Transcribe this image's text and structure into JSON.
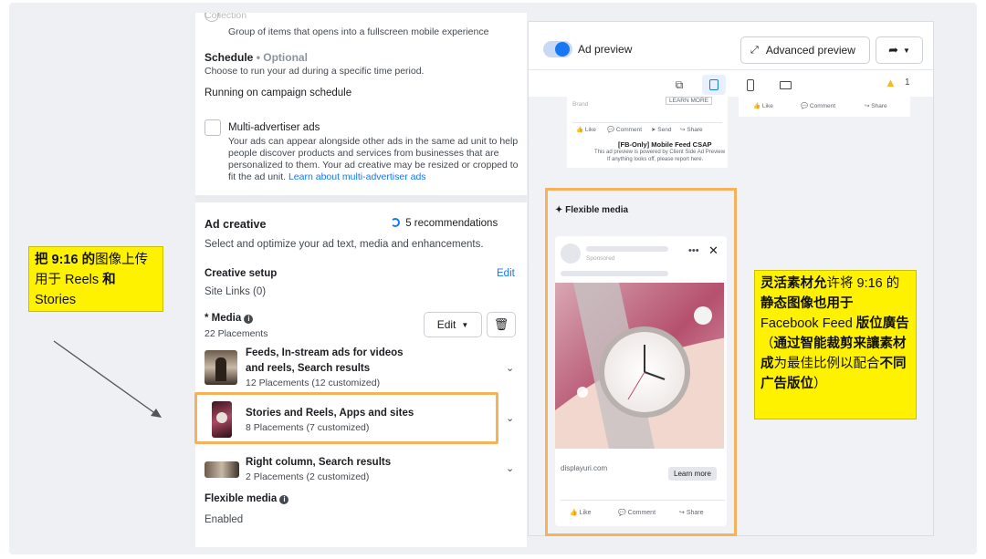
{
  "collection": {
    "title": "Collection",
    "desc": "Group of items that opens into a fullscreen mobile experience"
  },
  "schedule": {
    "title": "Schedule",
    "optional": "Optional",
    "desc": "Choose to run your ad during a specific time period.",
    "value": "Running on campaign schedule"
  },
  "multi_advertiser": {
    "title": "Multi-advertiser ads",
    "lines": [
      "Your ads can appear alongside other ads in the same ad unit to help",
      "people discover products and services from businesses that are",
      "personalized to them. Your ad creative may be resized or cropped to"
    ],
    "last_line": "fit the ad unit.",
    "link": "Learn about multi-advertiser ads"
  },
  "ad_creative": {
    "title": "Ad creative",
    "recommendations": "5 recommendations",
    "desc": "Select and optimize your ad text, media and enhancements."
  },
  "creative_setup": {
    "title": "Creative setup",
    "edit": "Edit",
    "site_links": "Site Links (0)"
  },
  "media": {
    "title": "* Media",
    "placements": "22 Placements",
    "edit_label": "Edit",
    "groups": [
      {
        "title_1": "Feeds, In-stream ads for videos",
        "title_2": "and reels, Search results",
        "sub": "12 Placements (12 customized)"
      },
      {
        "title_1": "Stories and Reels, Apps and sites",
        "sub": "8 Placements (7 customized)"
      },
      {
        "title_1": "Right column, Search results",
        "sub": "2 Placements (2 customized)"
      }
    ]
  },
  "flexible_media": {
    "title": "Flexible media",
    "status": "Enabled"
  },
  "preview": {
    "toggle_label": "Ad preview",
    "advanced_label": "Advanced preview",
    "warning_count": "1",
    "top_card": {
      "learn_more": "LEARN MORE",
      "brand": "Brand",
      "like": "Like",
      "comment": "Comment",
      "send": "Send",
      "share": "Share",
      "csap_title": "[FB-Only] Mobile Feed CSAP",
      "csap_line1": "This ad preview is powered by Client Side Ad Preview",
      "csap_line2": "If anything looks off, please report here."
    },
    "right_card": {
      "like": "Like",
      "comment": "Comment",
      "share": "Share"
    },
    "flexible_card": {
      "label": "Flexible media",
      "sponsored": "Sponsored",
      "domain": "displayuri.com",
      "learn_more": "Learn more",
      "like": "Like",
      "comment": "Comment",
      "share": "Share"
    }
  },
  "annotations": {
    "left": {
      "part1": "把 9:16 的",
      "part2": "图像上传用于 Reels ",
      "part3": "和",
      "part4": " Stories"
    },
    "right": {
      "bold1": "灵活素材允",
      "text1": "许将 9:16 的",
      "bold2": "静态图像也用于",
      "text2": " Facebook Feed ",
      "bold3": "版位廣告",
      "text3": "（",
      "bold4": "通过智能裁剪来讓素材成",
      "text4": "为最佳比例以配合",
      "bold5": "不同广告版位",
      "text5": "）"
    }
  },
  "colors": {
    "accent": "#1877f2",
    "highlight": "#f5b25b",
    "annotation": "#fff200",
    "warning": "#f7b928"
  }
}
